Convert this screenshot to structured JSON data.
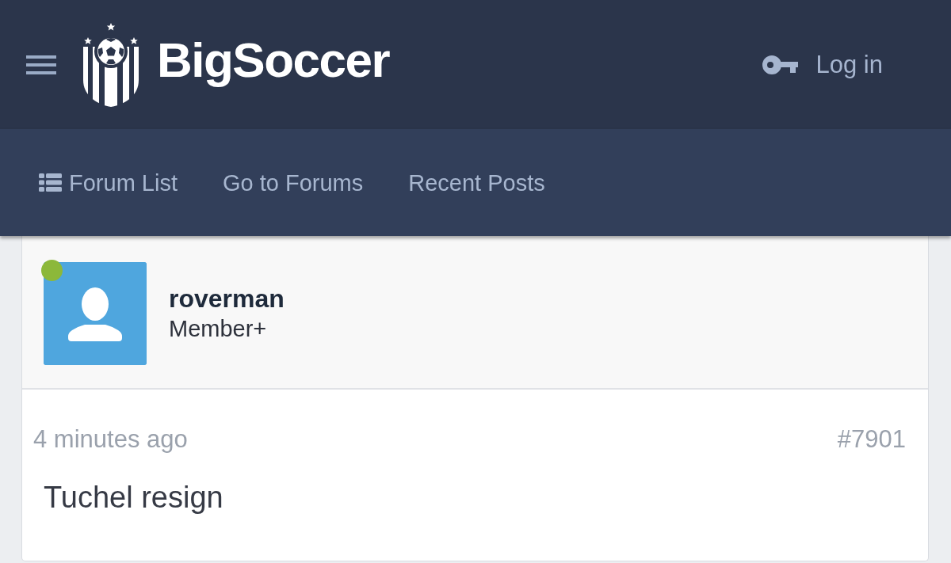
{
  "header": {
    "logo": "BigSoccer",
    "login": "Log in"
  },
  "nav": [
    {
      "label": "Forum List",
      "kind": "iconlink"
    },
    {
      "label": "Go to Forums",
      "kind": "link"
    },
    {
      "label": "Recent Posts",
      "kind": "link"
    }
  ],
  "post": {
    "author": {
      "name": "roverman",
      "title": "Member+",
      "online": true
    },
    "time": "4 minutes ago",
    "number": "#7901",
    "body": "Tuchel resign"
  }
}
